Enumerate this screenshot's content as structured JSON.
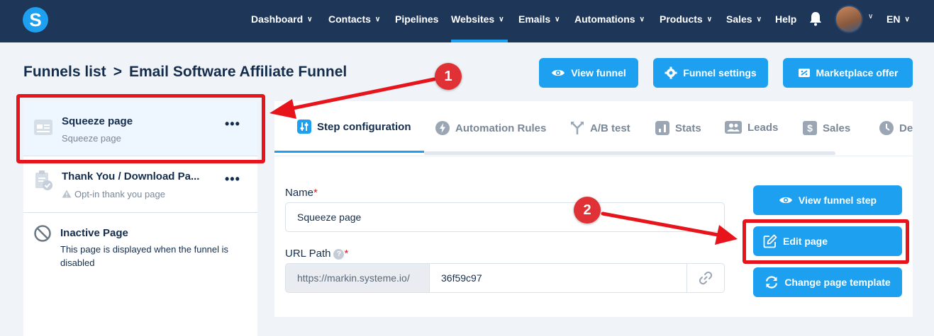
{
  "nav": {
    "items": [
      {
        "label": "Dashboard",
        "chevron": true
      },
      {
        "label": "Contacts",
        "chevron": true
      },
      {
        "label": "Pipelines",
        "chevron": false
      },
      {
        "label": "Websites",
        "chevron": true,
        "active": true
      },
      {
        "label": "Emails",
        "chevron": true
      },
      {
        "label": "Automations",
        "chevron": true
      },
      {
        "label": "Products",
        "chevron": true
      },
      {
        "label": "Sales",
        "chevron": true
      },
      {
        "label": "Help",
        "chevron": false
      }
    ],
    "language": "EN",
    "logo_letter": "S"
  },
  "breadcrumb": {
    "parent": "Funnels list",
    "separator": ">",
    "current": "Email Software Affiliate Funnel"
  },
  "header_buttons": {
    "view_funnel": "View funnel",
    "funnel_settings": "Funnel settings",
    "marketplace_offer": "Marketplace offer"
  },
  "steps": [
    {
      "title": "Squeeze page",
      "subtitle": "Squeeze page"
    },
    {
      "title": "Thank You / Download Pa...",
      "subtitle": "Opt-in thank you page"
    },
    {
      "title": "Inactive Page",
      "subtitle_line1": "This page is displayed when the funnel is",
      "subtitle_line2": "disabled"
    }
  ],
  "tabs": [
    {
      "label": "Step configuration",
      "active": true
    },
    {
      "label": "Automation Rules"
    },
    {
      "label": "A/B test"
    },
    {
      "label": "Stats"
    },
    {
      "label": "Leads"
    },
    {
      "label": "Sales"
    },
    {
      "label": "De"
    }
  ],
  "form": {
    "name_label": "Name",
    "name_value": "Squeeze page",
    "url_label": "URL Path",
    "url_prefix": "https://markin.systeme.io/",
    "url_value": "36f59c97",
    "required_mark": "*",
    "help_mark": "?"
  },
  "step_buttons": {
    "view_step": "View funnel step",
    "edit_page": "Edit page",
    "change_template": "Change page template"
  },
  "annotations": {
    "badge_1": "1",
    "badge_2": "2"
  },
  "colors": {
    "nav_bg": "#1e3658",
    "accent": "#1ea0f0",
    "annotation_red": "#e8141b",
    "text_dark": "#142d4c"
  }
}
